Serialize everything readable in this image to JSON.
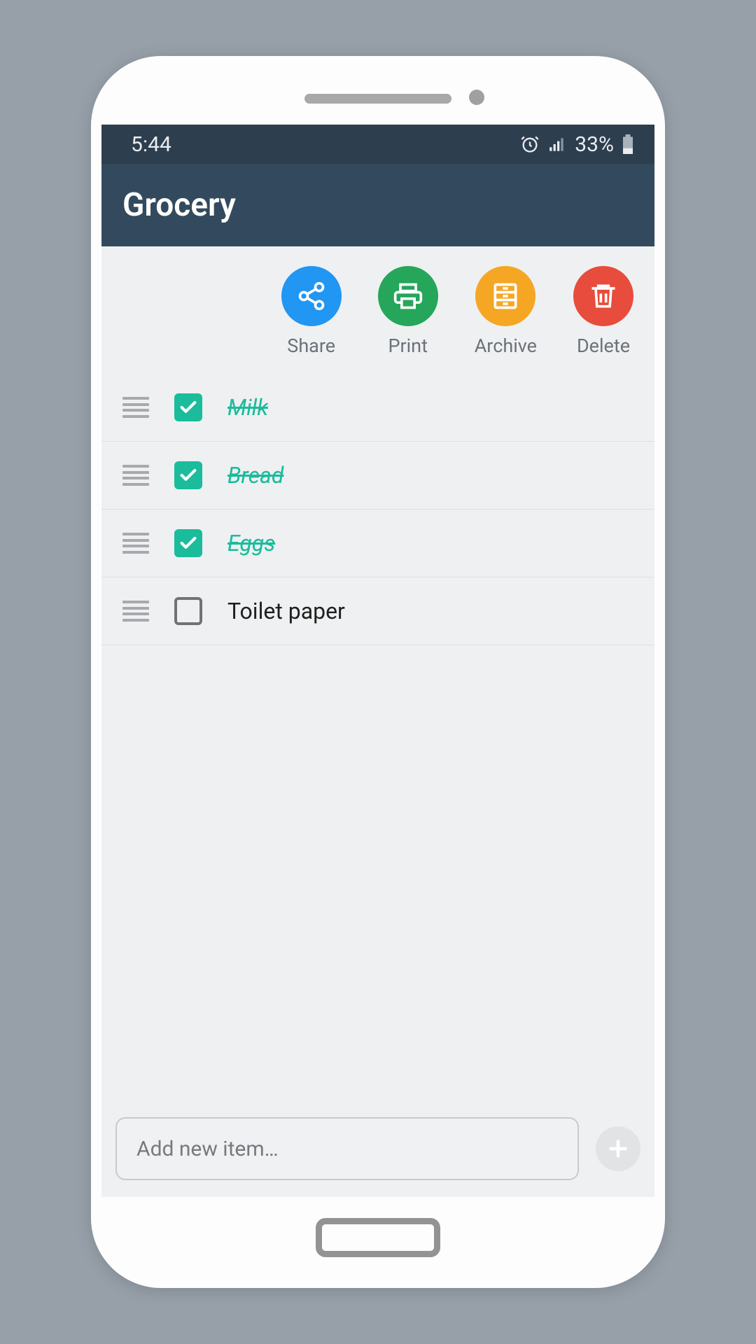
{
  "status_bar": {
    "time": "5:44",
    "battery_text": "33%"
  },
  "header": {
    "title": "Grocery"
  },
  "actions": {
    "share": {
      "label": "Share",
      "color": "#2196f3"
    },
    "print": {
      "label": "Print",
      "color": "#26a65b"
    },
    "archive": {
      "label": "Archive",
      "color": "#f5a623"
    },
    "delete": {
      "label": "Delete",
      "color": "#e74c3c"
    }
  },
  "items": [
    {
      "text": "Milk",
      "checked": true
    },
    {
      "text": "Bread",
      "checked": true
    },
    {
      "text": "Eggs",
      "checked": true
    },
    {
      "text": "Toilet paper",
      "checked": false
    }
  ],
  "input": {
    "placeholder": "Add new item…"
  }
}
